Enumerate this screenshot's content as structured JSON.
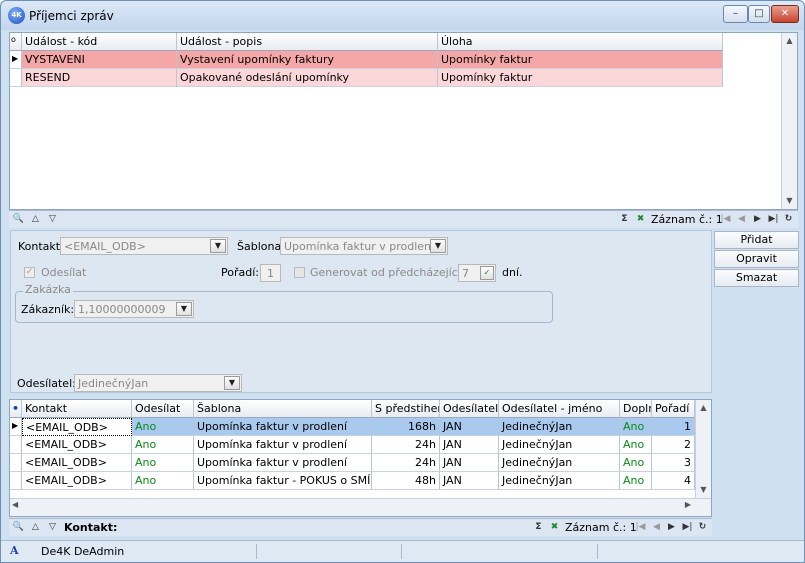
{
  "window": {
    "title": "Příjemci zpráv",
    "app_badge": "4K",
    "buttons": [
      "–",
      "□",
      "✕"
    ]
  },
  "top_grid": {
    "indicator": "o",
    "columns": [
      "Událost - kód",
      "Událost - popis",
      "Úloha"
    ],
    "rows": [
      {
        "code": "VYSTAVENI",
        "desc": "Vystavení upomínky faktury",
        "task": "Upomínky faktur"
      },
      {
        "code": "RESEND",
        "desc": "Opakované odeslání upomínky",
        "task": "Upomínky faktur"
      }
    ]
  },
  "top_nav": {
    "sigma": "Σ",
    "record_label": "Záznam č.: 1"
  },
  "form": {
    "kontakt_label": "Kontakt:",
    "kontakt_value": "<EMAIL_ODB>",
    "sablona_label": "Šablona:",
    "sablona_value": "Upomínka faktur v prodlení",
    "odesilat_label": "Odesílat",
    "poradi_label": "Pořadí:",
    "poradi_value": "1",
    "generovat_label": "Generovat od předcházející za",
    "generovat_value": "7",
    "dni_label": "dní.",
    "zakazka_group": "Zakázka",
    "zakaznik_label": "Zákazník:",
    "zakaznik_value": "1,10000000009",
    "odesilatel_label": "Odesílatel:",
    "odesilatel_value": "JedinečnýJan"
  },
  "side_buttons": {
    "add": "Přidat",
    "edit": "Opravit",
    "delete": "Smazat"
  },
  "bottom_grid": {
    "indicator": "•",
    "columns": [
      "Kontakt",
      "Odesílat",
      "Šablona",
      "S předstihem.",
      "Odesílatel",
      "Odesílatel - jméno",
      "Dopln",
      "Pořadí"
    ],
    "rows": [
      [
        "<EMAIL_ODB>",
        "Ano",
        "Upomínka faktur v prodlení",
        "168h",
        "JAN",
        "JedinečnýJan",
        "Ano",
        "1"
      ],
      [
        "<EMAIL_ODB>",
        "Ano",
        "Upomínka faktur v prodlení",
        "24h",
        "JAN",
        "JedinečnýJan",
        "Ano",
        "2"
      ],
      [
        "<EMAIL_ODB>",
        "Ano",
        "Upomínka faktur v prodlení",
        "24h",
        "JAN",
        "JedinečnýJan",
        "Ano",
        "3"
      ],
      [
        "<EMAIL_ODB>",
        "Ano",
        "Upomínka faktur - POKUS o SMÍR",
        "48h",
        "JAN",
        "JedinečnýJan",
        "Ano",
        "4"
      ]
    ]
  },
  "bottom_nav": {
    "filter_label": "Kontakt:",
    "sigma": "Σ",
    "record_label": "Záznam č.: 1"
  },
  "statusbar": {
    "icon": "A",
    "user": "De4K DeAdmin"
  },
  "colors": {
    "accent": "#cfe0f1",
    "row_highlight": "#f5a6a6",
    "row_pink": "#fbd7d9",
    "row_selected": "#a9c9ef",
    "green_text": "#0a8a16"
  }
}
